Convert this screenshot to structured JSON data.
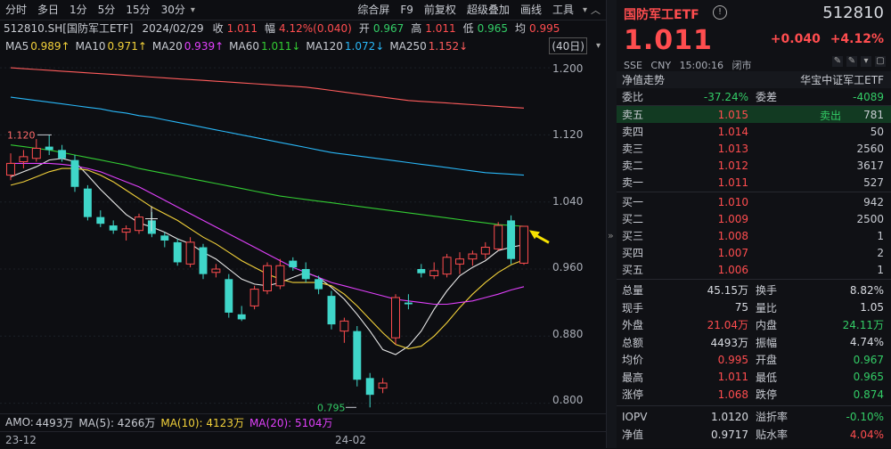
{
  "toolbar": {
    "left": [
      "分时",
      "多日",
      "1分",
      "5分",
      "15分",
      "30分"
    ],
    "right": [
      "综合屏",
      "F9",
      "前复权",
      "超级叠加",
      "画线",
      "工具"
    ]
  },
  "info": {
    "symbol": "512810.SH[国防军工ETF]",
    "date": "2024/02/29",
    "close_label": "收",
    "close": "1.011",
    "amp_label": "幅",
    "amp": "4.12%(0.040)",
    "open_label": "开",
    "open": "0.967",
    "high_label": "高",
    "high": "1.011",
    "low_label": "低",
    "low": "0.965",
    "avg_label": "均",
    "avg": "0.995",
    "period": "(40日)"
  },
  "ma": [
    {
      "label": "MA5",
      "value": "0.989↑",
      "color": "#e8e8e8"
    },
    {
      "label": "MA10",
      "value": "0.971↑",
      "color": "#f2d13a"
    },
    {
      "label": "MA20",
      "value": "0.939↑",
      "color": "#e040fb"
    },
    {
      "label": "MA60",
      "value": "1.011↓",
      "color": "#33cc33"
    },
    {
      "label": "MA120",
      "value": "1.072↓",
      "color": "#29b6f6"
    },
    {
      "label": "MA250",
      "value": "1.152↓",
      "color": "#ff5c5c"
    }
  ],
  "axis": {
    "ticks": [
      "1.200",
      "1.120",
      "1.040",
      "0.960",
      "0.880",
      "0.800"
    ]
  },
  "annotations": {
    "high": "1.120",
    "low": "0.795"
  },
  "amo": {
    "label": "AMO:",
    "value": "4493万",
    "ma5": "MA(5): 4266万",
    "ma10": "MA(10): 4123万",
    "ma20": "MA(20): 5104万"
  },
  "dates": [
    "23-12",
    "24-02"
  ],
  "colors": {
    "up": "#ff4d4f",
    "down": "#33cc66",
    "cyan": "#3fd6c9"
  },
  "chart_data": {
    "type": "candlestick",
    "ylim": [
      0.79,
      1.215
    ],
    "candles": [
      {
        "o": 1.072,
        "h": 1.098,
        "l": 1.066,
        "c": 1.086
      },
      {
        "o": 1.088,
        "h": 1.102,
        "l": 1.08,
        "c": 1.094
      },
      {
        "o": 1.092,
        "h": 1.115,
        "l": 1.088,
        "c": 1.104
      },
      {
        "o": 1.106,
        "h": 1.12,
        "l": 1.096,
        "c": 1.102
      },
      {
        "o": 1.102,
        "h": 1.108,
        "l": 1.088,
        "c": 1.092
      },
      {
        "o": 1.09,
        "h": 1.096,
        "l": 1.052,
        "c": 1.058
      },
      {
        "o": 1.056,
        "h": 1.06,
        "l": 1.018,
        "c": 1.022
      },
      {
        "o": 1.022,
        "h": 1.03,
        "l": 1.01,
        "c": 1.014
      },
      {
        "o": 1.012,
        "h": 1.018,
        "l": 1.002,
        "c": 1.006
      },
      {
        "o": 1.004,
        "h": 1.012,
        "l": 0.994,
        "c": 1.008
      },
      {
        "o": 1.006,
        "h": 1.026,
        "l": 1.002,
        "c": 1.022
      },
      {
        "o": 1.018,
        "h": 1.028,
        "l": 0.998,
        "c": 1.002
      },
      {
        "o": 1.0,
        "h": 1.004,
        "l": 0.986,
        "c": 0.994
      },
      {
        "o": 0.992,
        "h": 0.996,
        "l": 0.964,
        "c": 0.968
      },
      {
        "o": 0.966,
        "h": 0.998,
        "l": 0.962,
        "c": 0.992
      },
      {
        "o": 0.986,
        "h": 0.99,
        "l": 0.948,
        "c": 0.954
      },
      {
        "o": 0.956,
        "h": 0.966,
        "l": 0.95,
        "c": 0.96
      },
      {
        "o": 0.948,
        "h": 0.954,
        "l": 0.902,
        "c": 0.908
      },
      {
        "o": 0.906,
        "h": 0.916,
        "l": 0.898,
        "c": 0.9
      },
      {
        "o": 0.916,
        "h": 0.94,
        "l": 0.912,
        "c": 0.936
      },
      {
        "o": 0.934,
        "h": 0.968,
        "l": 0.93,
        "c": 0.964
      },
      {
        "o": 0.94,
        "h": 0.972,
        "l": 0.936,
        "c": 0.964
      },
      {
        "o": 0.97,
        "h": 0.974,
        "l": 0.958,
        "c": 0.962
      },
      {
        "o": 0.96,
        "h": 0.968,
        "l": 0.944,
        "c": 0.948
      },
      {
        "o": 0.948,
        "h": 0.952,
        "l": 0.93,
        "c": 0.936
      },
      {
        "o": 0.928,
        "h": 0.934,
        "l": 0.888,
        "c": 0.894
      },
      {
        "o": 0.886,
        "h": 0.902,
        "l": 0.872,
        "c": 0.898
      },
      {
        "o": 0.886,
        "h": 0.892,
        "l": 0.82,
        "c": 0.828
      },
      {
        "o": 0.83,
        "h": 0.836,
        "l": 0.795,
        "c": 0.81
      },
      {
        "o": 0.818,
        "h": 0.83,
        "l": 0.812,
        "c": 0.824
      },
      {
        "o": 0.878,
        "h": 0.93,
        "l": 0.87,
        "c": 0.926
      },
      {
        "o": 0.92,
        "h": 0.93,
        "l": 0.912,
        "c": 0.918
      },
      {
        "o": 0.96,
        "h": 0.966,
        "l": 0.95,
        "c": 0.955
      },
      {
        "o": 0.952,
        "h": 0.968,
        "l": 0.948,
        "c": 0.958
      },
      {
        "o": 0.954,
        "h": 0.978,
        "l": 0.95,
        "c": 0.974
      },
      {
        "o": 0.966,
        "h": 0.98,
        "l": 0.954,
        "c": 0.972
      },
      {
        "o": 0.972,
        "h": 0.982,
        "l": 0.964,
        "c": 0.978
      },
      {
        "o": 0.978,
        "h": 0.992,
        "l": 0.972,
        "c": 0.986
      },
      {
        "o": 0.984,
        "h": 1.016,
        "l": 0.982,
        "c": 1.012
      },
      {
        "o": 1.018,
        "h": 1.024,
        "l": 0.966,
        "c": 0.972
      },
      {
        "o": 0.967,
        "h": 1.011,
        "l": 0.965,
        "c": 1.011
      }
    ],
    "ma_lines": {
      "MA5": [
        1.07,
        1.076,
        1.082,
        1.09,
        1.092,
        1.088,
        1.072,
        1.055,
        1.04,
        1.025,
        1.015,
        1.01,
        1.004,
        0.996,
        0.99,
        0.98,
        0.972,
        0.96,
        0.948,
        0.942,
        0.94,
        0.944,
        0.95,
        0.956,
        0.95,
        0.938,
        0.924,
        0.906,
        0.886,
        0.864,
        0.858,
        0.868,
        0.886,
        0.912,
        0.934,
        0.952,
        0.962,
        0.97,
        0.982,
        0.986,
        0.989
      ],
      "MA10": [
        1.06,
        1.064,
        1.07,
        1.076,
        1.08,
        1.08,
        1.078,
        1.072,
        1.064,
        1.054,
        1.044,
        1.034,
        1.026,
        1.018,
        1.008,
        0.998,
        0.99,
        0.98,
        0.97,
        0.962,
        0.954,
        0.948,
        0.944,
        0.944,
        0.944,
        0.94,
        0.93,
        0.916,
        0.9,
        0.884,
        0.87,
        0.865,
        0.868,
        0.88,
        0.896,
        0.914,
        0.93,
        0.944,
        0.956,
        0.965,
        0.971
      ],
      "MA20": [
        1.086,
        1.086,
        1.086,
        1.086,
        1.085,
        1.083,
        1.08,
        1.076,
        1.07,
        1.064,
        1.058,
        1.05,
        1.042,
        1.034,
        1.026,
        1.018,
        1.01,
        1.002,
        0.994,
        0.986,
        0.978,
        0.97,
        0.962,
        0.956,
        0.95,
        0.944,
        0.94,
        0.936,
        0.932,
        0.928,
        0.924,
        0.922,
        0.92,
        0.918,
        0.918,
        0.92,
        0.922,
        0.926,
        0.93,
        0.935,
        0.939
      ],
      "MA60": [
        1.108,
        1.106,
        1.104,
        1.102,
        1.099,
        1.096,
        1.093,
        1.09,
        1.087,
        1.084,
        1.08,
        1.077,
        1.074,
        1.071,
        1.068,
        1.065,
        1.062,
        1.059,
        1.056,
        1.053,
        1.05,
        1.047,
        1.045,
        1.043,
        1.041,
        1.039,
        1.037,
        1.035,
        1.033,
        1.031,
        1.029,
        1.027,
        1.025,
        1.023,
        1.021,
        1.019,
        1.017,
        1.015,
        1.013,
        1.012,
        1.011
      ],
      "MA120": [
        1.165,
        1.163,
        1.161,
        1.159,
        1.157,
        1.155,
        1.153,
        1.151,
        1.148,
        1.146,
        1.143,
        1.141,
        1.138,
        1.135,
        1.132,
        1.129,
        1.126,
        1.123,
        1.12,
        1.117,
        1.114,
        1.111,
        1.108,
        1.105,
        1.102,
        1.099,
        1.097,
        1.095,
        1.093,
        1.091,
        1.089,
        1.087,
        1.085,
        1.083,
        1.081,
        1.079,
        1.077,
        1.075,
        1.074,
        1.073,
        1.072
      ],
      "MA250": [
        1.2,
        1.199,
        1.198,
        1.197,
        1.196,
        1.195,
        1.194,
        1.193,
        1.192,
        1.191,
        1.19,
        1.189,
        1.188,
        1.187,
        1.186,
        1.185,
        1.184,
        1.183,
        1.182,
        1.181,
        1.18,
        1.179,
        1.178,
        1.177,
        1.175,
        1.173,
        1.171,
        1.169,
        1.167,
        1.165,
        1.163,
        1.161,
        1.16,
        1.159,
        1.158,
        1.157,
        1.156,
        1.155,
        1.154,
        1.153,
        1.152
      ]
    }
  },
  "panel": {
    "title": "国防军工ETF",
    "code": "512810",
    "price": "1.011",
    "change": "+0.040",
    "change_pct": "+4.12%",
    "meta": [
      "SSE",
      "CNY",
      "15:00:16",
      "闭市"
    ],
    "nav_label": "净值走势",
    "index_label": "华宝中证军工ETF",
    "weibi_label": "委比",
    "weibi": "-37.24%",
    "weicha_label": "委差",
    "weicha": "-4089",
    "asks": [
      {
        "label": "卖五",
        "price": "1.015",
        "vol": "781"
      },
      {
        "label": "卖四",
        "price": "1.014",
        "vol": "50"
      },
      {
        "label": "卖三",
        "price": "1.013",
        "vol": "2560"
      },
      {
        "label": "卖二",
        "price": "1.012",
        "vol": "3617"
      },
      {
        "label": "卖一",
        "price": "1.011",
        "vol": "527"
      }
    ],
    "sellout_tag": "卖出",
    "bids": [
      {
        "label": "买一",
        "price": "1.010",
        "vol": "942"
      },
      {
        "label": "买二",
        "price": "1.009",
        "vol": "2500"
      },
      {
        "label": "买三",
        "price": "1.008",
        "vol": "1"
      },
      {
        "label": "买四",
        "price": "1.007",
        "vol": "2"
      },
      {
        "label": "买五",
        "price": "1.006",
        "vol": "1"
      }
    ],
    "stats": [
      [
        {
          "l": "总量",
          "v": "45.15万",
          "c": "#d8dbe1"
        },
        {
          "l": "换手",
          "v": "8.82%",
          "c": "#d8dbe1"
        }
      ],
      [
        {
          "l": "现手",
          "v": "75",
          "c": "#d8dbe1"
        },
        {
          "l": "量比",
          "v": "1.05",
          "c": "#d8dbe1"
        }
      ],
      [
        {
          "l": "外盘",
          "v": "21.04万",
          "c": "#ff4d4f"
        },
        {
          "l": "内盘",
          "v": "24.11万",
          "c": "#33cc66"
        }
      ],
      [
        {
          "l": "总额",
          "v": "4493万",
          "c": "#d8dbe1"
        },
        {
          "l": "振幅",
          "v": "4.74%",
          "c": "#d8dbe1"
        }
      ],
      [
        {
          "l": "均价",
          "v": "0.995",
          "c": "#ff4d4f"
        },
        {
          "l": "开盘",
          "v": "0.967",
          "c": "#33cc66"
        }
      ],
      [
        {
          "l": "最高",
          "v": "1.011",
          "c": "#ff4d4f"
        },
        {
          "l": "最低",
          "v": "0.965",
          "c": "#33cc66"
        }
      ],
      [
        {
          "l": "涨停",
          "v": "1.068",
          "c": "#ff4d4f"
        },
        {
          "l": "跌停",
          "v": "0.874",
          "c": "#33cc66"
        }
      ]
    ],
    "stats2": [
      [
        {
          "l": "IOPV",
          "v": "1.0120",
          "c": "#d8dbe1"
        },
        {
          "l": "溢折率",
          "v": "-0.10%",
          "c": "#33cc66"
        }
      ],
      [
        {
          "l": "净值",
          "v": "0.9717",
          "c": "#d8dbe1"
        },
        {
          "l": "贴水率",
          "v": "4.04%",
          "c": "#ff4d4f"
        }
      ]
    ]
  }
}
